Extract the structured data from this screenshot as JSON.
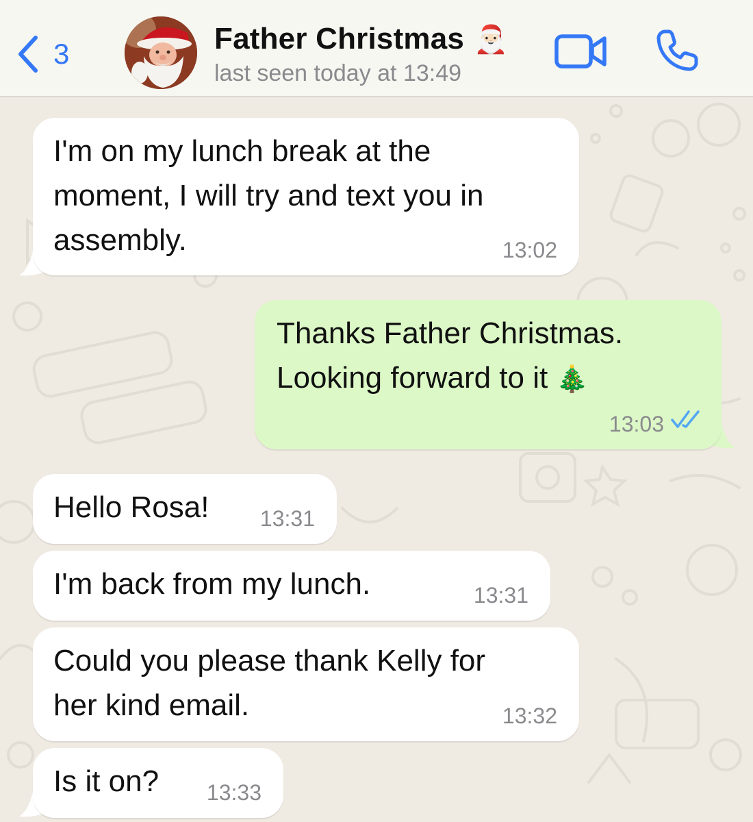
{
  "header": {
    "back_count": "3",
    "contact_name": "Father Christmas",
    "contact_emoji": "🎅🏻",
    "status": "last seen today at 13:49",
    "icons": {
      "back": "chevron-left-icon",
      "video": "video-camera-icon",
      "call": "phone-icon"
    },
    "accent_color": "#3478f6"
  },
  "messages": [
    {
      "direction": "incoming",
      "text": "I'm on my lunch break at the\nmoment, I will try and text you in\nassembly.",
      "time": "13:02"
    },
    {
      "direction": "outgoing",
      "text": "Thanks Father Christmas.\nLooking forward to it",
      "emoji": "🎄",
      "time": "13:03",
      "read": true
    },
    {
      "direction": "incoming",
      "text": "Hello Rosa!",
      "time": "13:31"
    },
    {
      "direction": "incoming",
      "text": "I'm back from my lunch.",
      "time": "13:31"
    },
    {
      "direction": "incoming",
      "text": "Could you please thank Kelly for\nher kind email.",
      "time": "13:32"
    },
    {
      "direction": "incoming",
      "text": "Is it on?",
      "time": "13:33"
    }
  ],
  "colors": {
    "incoming_bubble": "#ffffff",
    "outgoing_bubble": "#dcf8c7",
    "read_ticks": "#53a6f2",
    "chat_background": "#efeae2"
  }
}
